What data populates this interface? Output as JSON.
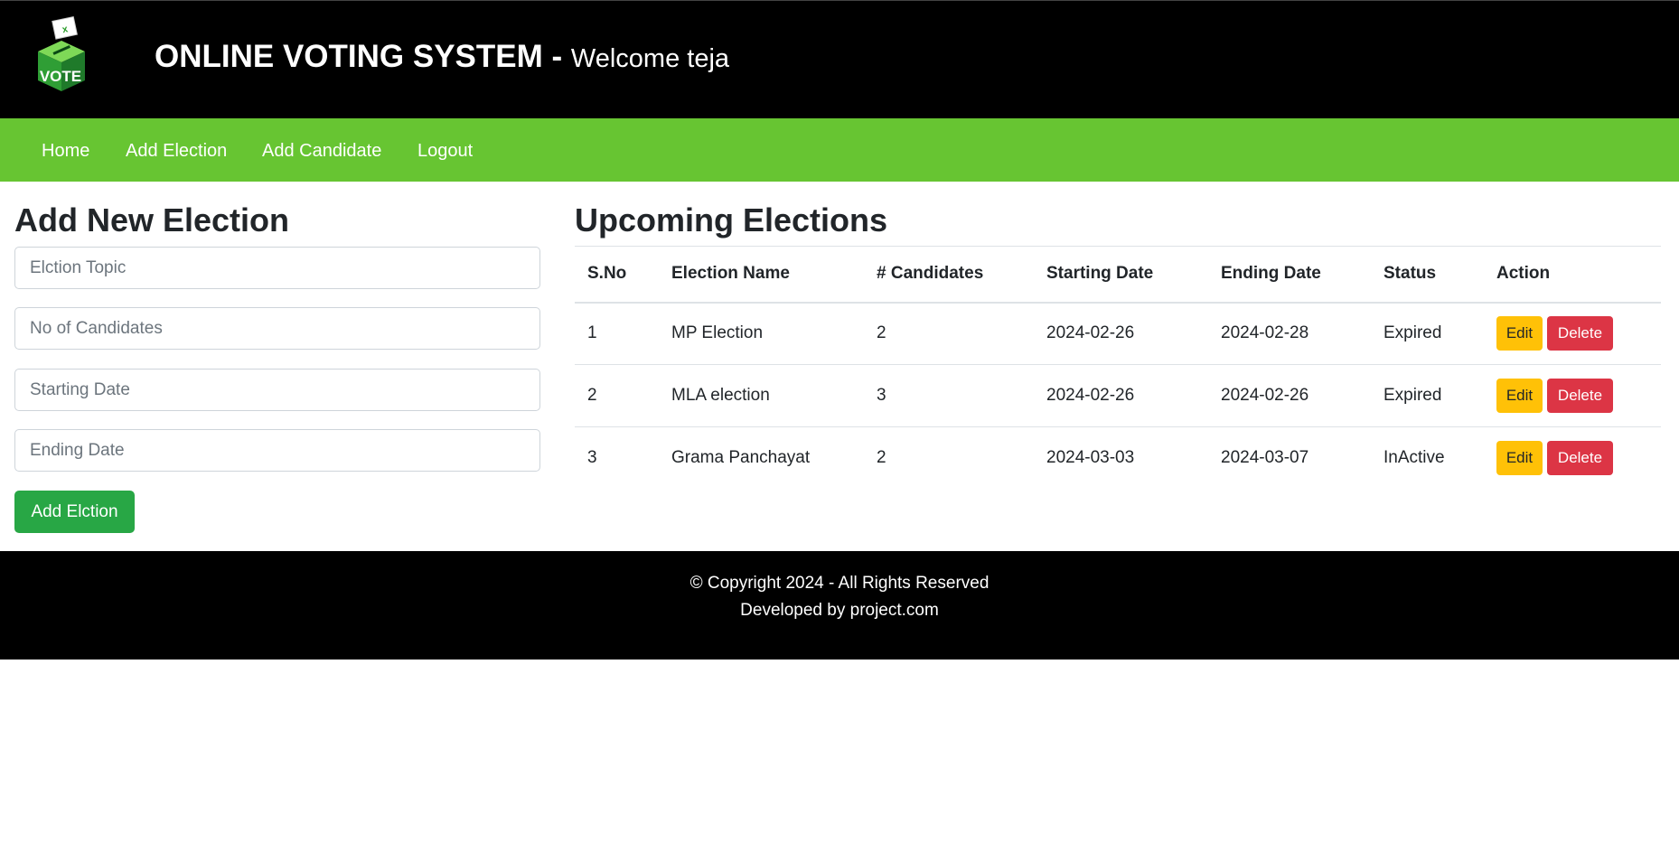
{
  "header": {
    "logo_text": "VOTE",
    "title": "ONLINE VOTING SYSTEM",
    "separator": " - ",
    "welcome": "Welcome teja"
  },
  "nav": {
    "items": [
      {
        "label": "Home"
      },
      {
        "label": "Add Election"
      },
      {
        "label": "Add Candidate"
      },
      {
        "label": "Logout"
      }
    ]
  },
  "add_election": {
    "heading": "Add New Election",
    "topic_placeholder": "Elction Topic",
    "candidates_placeholder": "No of Candidates",
    "start_placeholder": "Starting Date",
    "end_placeholder": "Ending Date",
    "submit_label": "Add Elction"
  },
  "upcoming": {
    "heading": "Upcoming Elections",
    "columns": [
      "S.No",
      "Election Name",
      "# Candidates",
      "Starting Date",
      "Ending Date",
      "Status",
      "Action"
    ],
    "rows": [
      {
        "sno": "1",
        "name": "MP Election",
        "candidates": "2",
        "start": "2024-02-26",
        "end": "2024-02-28",
        "status": "Expired"
      },
      {
        "sno": "2",
        "name": "MLA election",
        "candidates": "3",
        "start": "2024-02-26",
        "end": "2024-02-26",
        "status": "Expired"
      },
      {
        "sno": "3",
        "name": "Grama Panchayat",
        "candidates": "2",
        "start": "2024-03-03",
        "end": "2024-03-07",
        "status": "InActive"
      }
    ],
    "edit_label": "Edit",
    "delete_label": "Delete"
  },
  "footer": {
    "copyright": "© Copyright 2024 - All Rights Reserved",
    "developed": "Developed by project.com"
  },
  "colors": {
    "header_bg": "#000000",
    "nav_bg": "#67c532",
    "primary_button": "#28a745",
    "edit_button": "#ffc107",
    "delete_button": "#dc3545"
  }
}
